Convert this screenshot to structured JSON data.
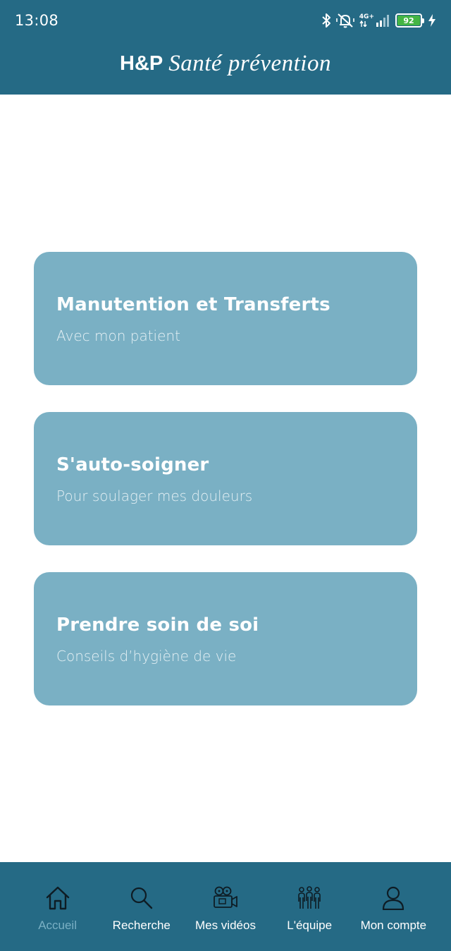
{
  "status_bar": {
    "time": "13:08",
    "network": "4G+",
    "battery": "92",
    "icons": [
      "bluetooth-icon",
      "vibrate-off-icon",
      "signal-icon",
      "battery-icon",
      "charging-icon"
    ]
  },
  "header": {
    "brand": "H&P",
    "tagline": "Santé prévention",
    "background": "#256a85"
  },
  "cards": [
    {
      "title": "Manutention et Transferts",
      "subtitle": "Avec mon patient"
    },
    {
      "title": "S'auto-soigner",
      "subtitle": "Pour soulager mes douleurs"
    },
    {
      "title": "Prendre soin de soi",
      "subtitle": "Conseils d’hygiène de vie"
    }
  ],
  "card_color": "#7ab0c4",
  "bottom_nav": {
    "active": "Accueil",
    "items": [
      {
        "label": "Accueil",
        "icon": "home-icon"
      },
      {
        "label": "Recherche",
        "icon": "search-icon"
      },
      {
        "label": "Mes vidéos",
        "icon": "video-camera-icon"
      },
      {
        "label": "L'équipe",
        "icon": "team-icon"
      },
      {
        "label": "Mon compte",
        "icon": "user-icon"
      }
    ]
  }
}
